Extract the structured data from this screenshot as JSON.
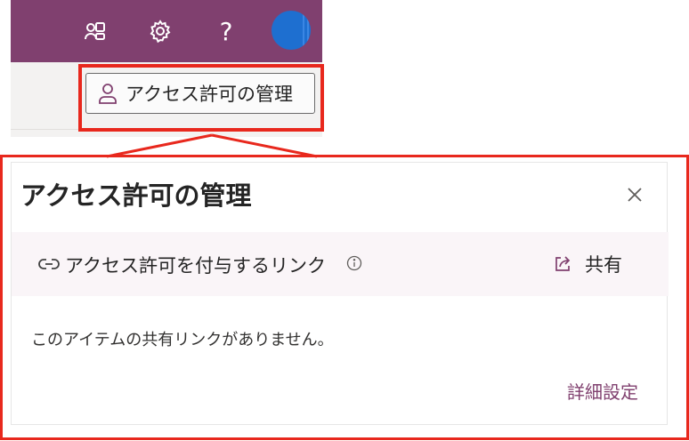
{
  "toolbar": {
    "icons": [
      "people-group-icon",
      "gear-icon",
      "help-icon",
      "avatar"
    ],
    "help_glyph": "?"
  },
  "manage_button": {
    "label": "アクセス許可の管理"
  },
  "panel": {
    "title": "アクセス許可の管理",
    "close_glyph": "×",
    "link_section": {
      "label": "アクセス許可を付与するリンク",
      "share_label": "共有"
    },
    "empty_message": "このアイテムの共有リンクがありません。",
    "advanced_link": "詳細設定"
  },
  "colors": {
    "brand": "#80406f",
    "highlight": "#e8281d",
    "link_row_bg": "#faf5f8"
  }
}
